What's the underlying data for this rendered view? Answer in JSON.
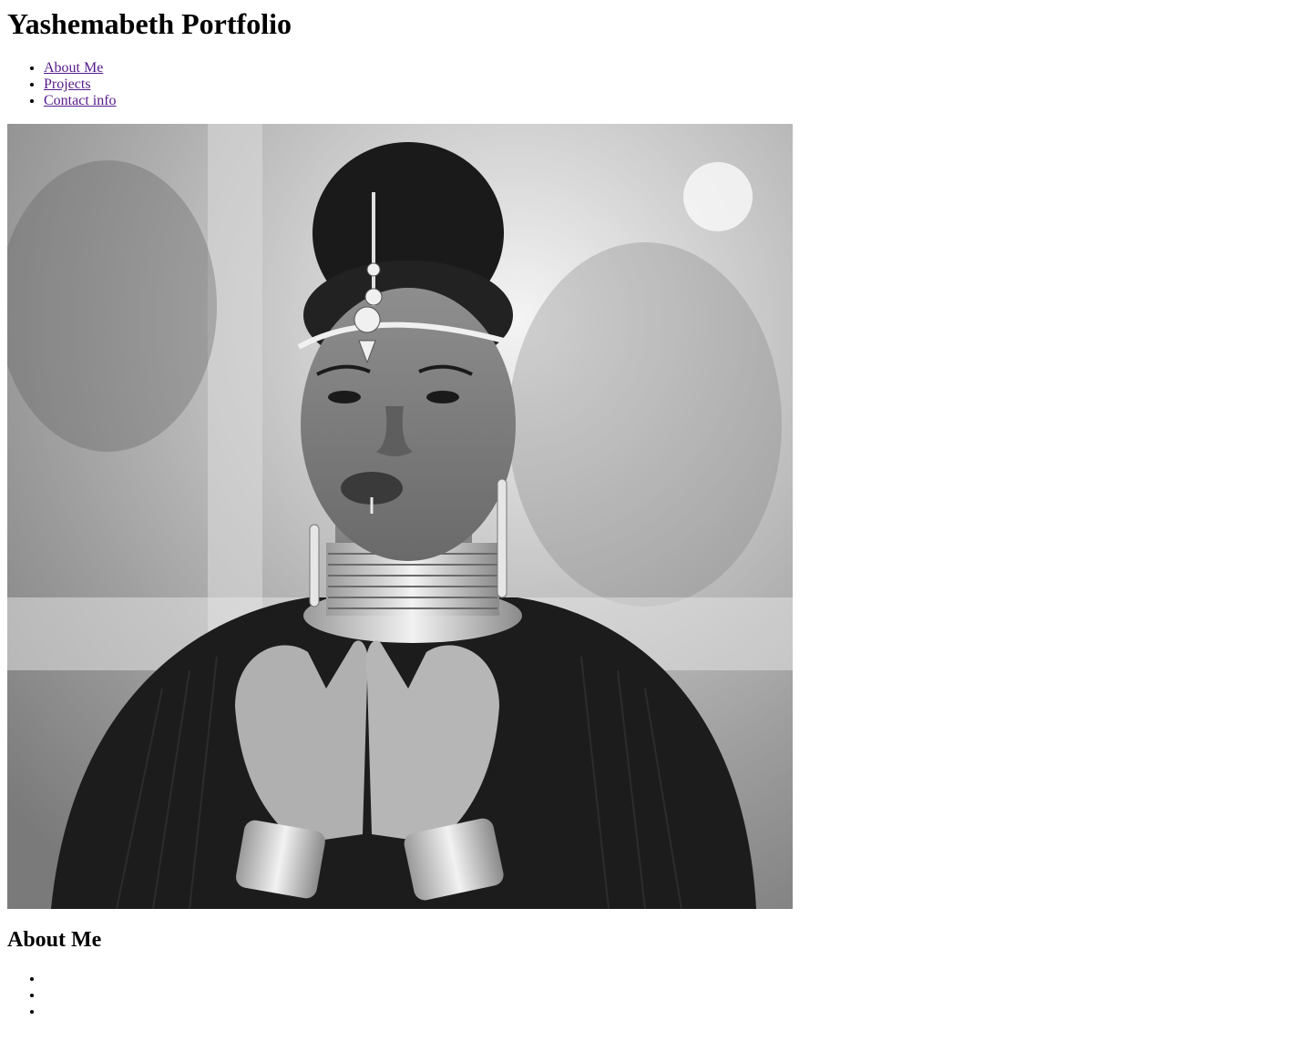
{
  "header": {
    "title": "Yashemabeth Portfolio"
  },
  "nav": {
    "items": [
      {
        "label": "About Me"
      },
      {
        "label": "Projects"
      },
      {
        "label": "Contact info"
      }
    ]
  },
  "hero": {
    "image_alt": "Black and white portrait photograph"
  },
  "about": {
    "heading": "About Me",
    "items": [
      "",
      "",
      ""
    ]
  },
  "colors": {
    "link_visited": "#551a8b",
    "text": "#000000",
    "background": "#ffffff"
  }
}
